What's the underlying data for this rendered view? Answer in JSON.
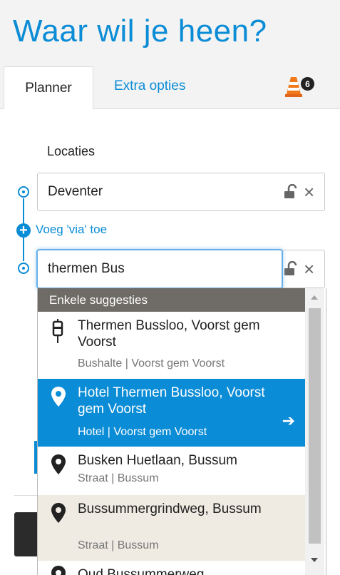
{
  "header": {
    "title": "Waar wil je heen?"
  },
  "tabs": {
    "planner": "Planner",
    "extra": "Extra opties",
    "notification_count": "6"
  },
  "form": {
    "locations_label": "Locaties",
    "from": {
      "value": "Deventer"
    },
    "add_via": "Voeg 'via' toe",
    "to": {
      "value": "thermen Bus"
    }
  },
  "suggestions": {
    "header": "Enkele suggesties",
    "items": [
      {
        "title": "Thermen Bussloo, Voorst gem Voorst",
        "subtitle": "Bushalte | Voorst gem Voorst",
        "icon": "bus-stop-icon"
      },
      {
        "title": "Hotel Thermen Bussloo, Voorst gem Voorst",
        "subtitle": "Hotel | Voorst gem Voorst",
        "icon": "map-pin-icon"
      },
      {
        "title": "Busken Huetlaan, Bussum",
        "subtitle": "Straat | Bussum",
        "icon": "map-pin-icon"
      },
      {
        "title": "Bussummergrindweg, Bussum",
        "subtitle": "Straat | Bussum",
        "icon": "map-pin-icon"
      },
      {
        "title": "Oud Bussummerweg",
        "subtitle": "",
        "icon": "map-pin-icon"
      }
    ]
  },
  "colors": {
    "brand": "#0a8cd6",
    "suggestion_header": "#6f6c67",
    "hover_row": "#efeae2"
  }
}
